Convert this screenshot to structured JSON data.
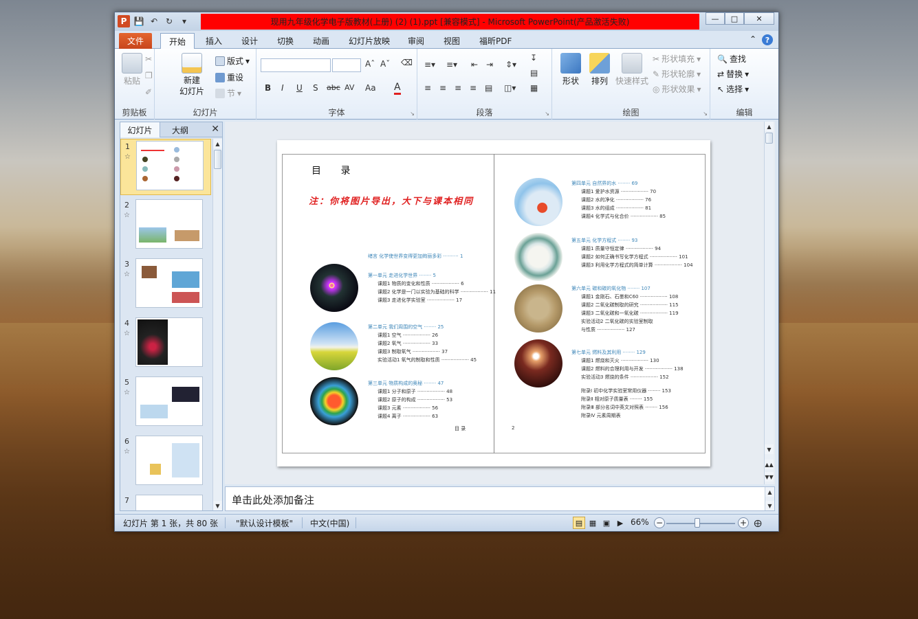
{
  "window": {
    "title": "现用九年级化学电子版教材(上册) (2) (1).ppt [兼容模式] - Microsoft PowerPoint(产品激活失败)",
    "app_icon": "P"
  },
  "tabs": [
    "文件",
    "开始",
    "插入",
    "设计",
    "切换",
    "动画",
    "幻灯片放映",
    "审阅",
    "视图",
    "福昕PDF"
  ],
  "ribbon": {
    "clipboard": {
      "label": "剪贴板",
      "paste": "粘贴"
    },
    "slides": {
      "label": "幻灯片",
      "new_slide_line1": "新建",
      "new_slide_line2": "幻灯片",
      "layout": "版式",
      "reset": "重设",
      "section": "节"
    },
    "font": {
      "label": "字体",
      "bold": "B",
      "italic": "I",
      "underline": "U",
      "shadow": "S",
      "strike": "abc",
      "spacing": "AV",
      "case": "Aa",
      "color": "A"
    },
    "paragraph": {
      "label": "段落"
    },
    "drawing": {
      "label": "绘图",
      "shapes": "形状",
      "arrange": "排列",
      "quick_styles": "快速样式",
      "shape_fill": "形状填充",
      "shape_outline": "形状轮廓",
      "shape_effects": "形状效果"
    },
    "editing": {
      "label": "编辑",
      "find": "查找",
      "replace": "替换",
      "select": "选择"
    }
  },
  "left_pane": {
    "tab_slides": "幻灯片",
    "tab_outline": "大纲",
    "thumbnails": [
      "1",
      "2",
      "3",
      "4",
      "5",
      "6",
      "7"
    ]
  },
  "slide": {
    "toc_title": "目 录",
    "note": "注：你将图片导出，大下与课本相同",
    "intro": {
      "text": "绪言 化学使世界变得更加绚丽多彩",
      "page": "1"
    },
    "left_units": [
      {
        "unit": "第一单元 走进化学世界",
        "page": "5",
        "lessons": [
          {
            "t": "课题1 物质的变化和性质",
            "p": "6"
          },
          {
            "t": "课题2 化学是一门以实验为基础的科学",
            "p": "11"
          },
          {
            "t": "课题3 走进化学实验室",
            "p": "17"
          }
        ]
      },
      {
        "unit": "第二单元 我们周围的空气",
        "page": "25",
        "lessons": [
          {
            "t": "课题1 空气",
            "p": "26"
          },
          {
            "t": "课题2 氧气",
            "p": "33"
          },
          {
            "t": "课题3 制取氧气",
            "p": "37"
          },
          {
            "t": "实验活动1 氧气的制取和性质",
            "p": "45"
          }
        ]
      },
      {
        "unit": "第三单元 物质构成的奥秘",
        "page": "47",
        "lessons": [
          {
            "t": "课题1 分子和原子",
            "p": "48"
          },
          {
            "t": "课题2 原子的构成",
            "p": "53"
          },
          {
            "t": "课题3 元素",
            "p": "56"
          },
          {
            "t": "课题4 离子",
            "p": "63"
          }
        ]
      }
    ],
    "right_units": [
      {
        "unit": "第四单元 自然界的水",
        "page": "69",
        "lessons": [
          {
            "t": "课题1 爱护水资源",
            "p": "70"
          },
          {
            "t": "课题2 水的净化",
            "p": "76"
          },
          {
            "t": "课题3 水的组成",
            "p": "81"
          },
          {
            "t": "课题4 化学式与化合价",
            "p": "85"
          }
        ]
      },
      {
        "unit": "第五单元 化学方程式",
        "page": "93",
        "lessons": [
          {
            "t": "课题1 质量守恒定律",
            "p": "94"
          },
          {
            "t": "课题2 如何正确书写化学方程式",
            "p": "101"
          },
          {
            "t": "课题3 利用化学方程式的简单计算",
            "p": "104"
          }
        ]
      },
      {
        "unit": "第六单元 碳和碳的氧化物",
        "page": "107",
        "lessons": [
          {
            "t": "课题1 金刚石、石墨和C60",
            "p": "108"
          },
          {
            "t": "课题2 二氧化碳制取的研究",
            "p": "115"
          },
          {
            "t": "课题3 二氧化碳和一氧化碳",
            "p": "119"
          },
          {
            "t": "实验活动2 二氧化碳的实验室制取",
            "p": ""
          },
          {
            "t": "与性质",
            "p": "127"
          }
        ]
      },
      {
        "unit": "第七单元 燃料及其利用",
        "page": "129",
        "lessons": [
          {
            "t": "课题1 燃烧和灭火",
            "p": "130"
          },
          {
            "t": "课题2 燃料的合理利用与开发",
            "p": "138"
          },
          {
            "t": "实验活动3 燃烧的条件",
            "p": "152"
          }
        ]
      }
    ],
    "appendix": [
      {
        "t": "附录Ⅰ 初中化学实验室常用仪器",
        "p": "153"
      },
      {
        "t": "附录Ⅱ 相对原子质量表",
        "p": "155"
      },
      {
        "t": "附录Ⅲ 部分名词中英文对照表",
        "p": "156"
      },
      {
        "t": "附录Ⅳ 元素周期表",
        "p": ""
      }
    ],
    "page_left": "目 录",
    "page_right": "2"
  },
  "notes_placeholder": "单击此处添加备注",
  "status": {
    "slide_info": "幻灯片 第 1 张，共 80 张",
    "theme": "\"默认设计模板\"",
    "language": "中文(中国)",
    "zoom": "66%",
    "zoom_fraction": 0.45
  },
  "colors": {
    "accent_red": "#ff0000",
    "file_tab": "#d14a22",
    "toc_blue": "#3d86b8",
    "note_red": "#e02020"
  }
}
